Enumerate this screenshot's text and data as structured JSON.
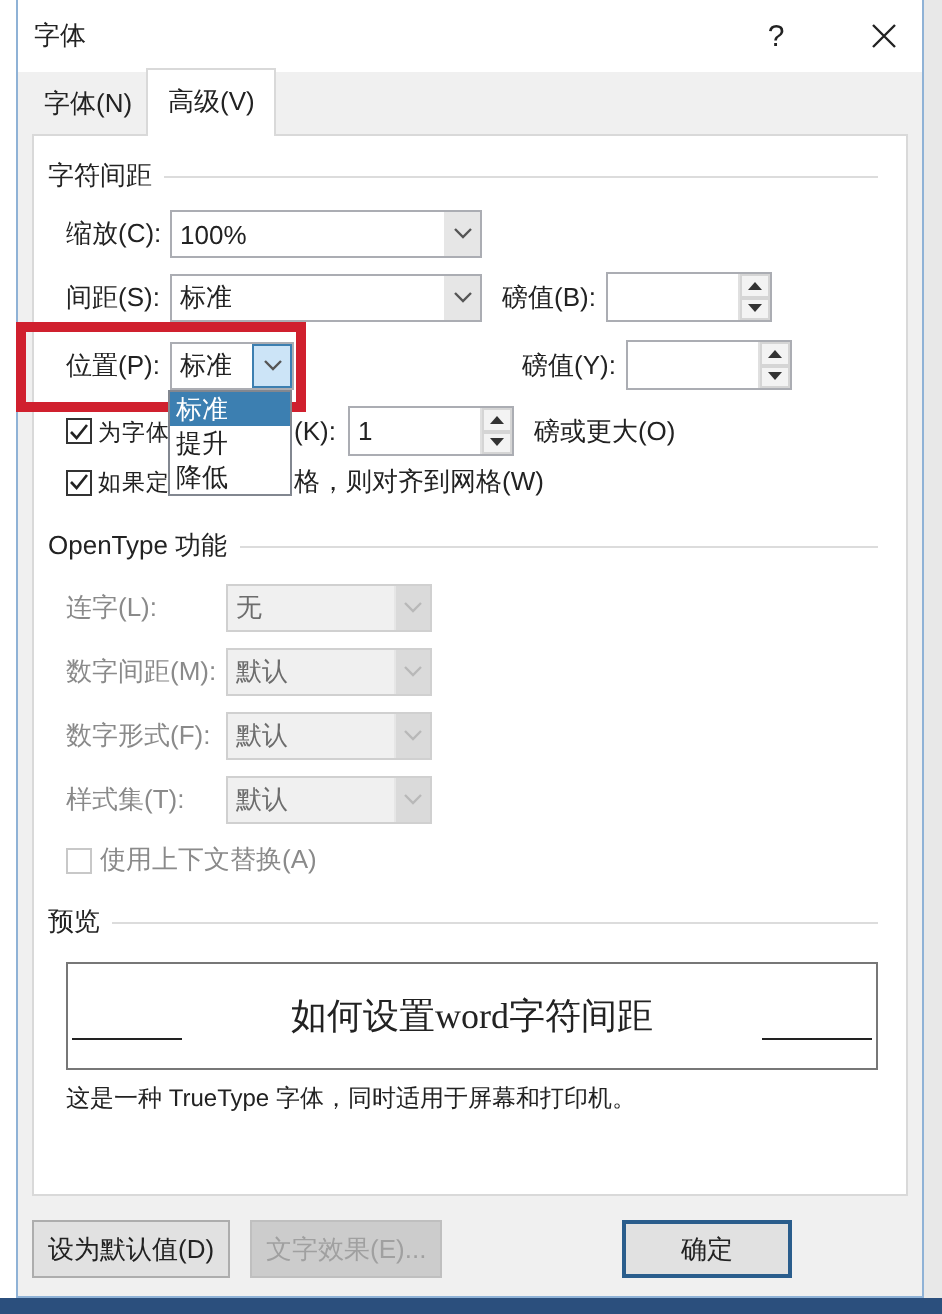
{
  "window": {
    "title": "字体",
    "help_button": "?"
  },
  "tabs": [
    {
      "label": "字体(N)",
      "selected": false
    },
    {
      "label": "高级(V)",
      "selected": true
    }
  ],
  "character_spacing": {
    "heading": "字符间距",
    "scale": {
      "label": "缩放(C):",
      "value": "100%"
    },
    "spacing": {
      "label": "间距(S):",
      "value": "标准",
      "points_label": "磅值(B):"
    },
    "position": {
      "label": "位置(P):",
      "value": "标准",
      "points_label": "磅值(Y):",
      "dropdown": {
        "open": true,
        "options": [
          {
            "label": "标准",
            "selected": true
          },
          {
            "label": "提升",
            "selected": false
          },
          {
            "label": "降低",
            "selected": false
          }
        ]
      }
    },
    "kerning": {
      "checked": true,
      "label_parts": [
        "为字体",
        "(K):"
      ],
      "value": "1",
      "suffix": "磅或更大(O)"
    },
    "snap_to_grid": {
      "checked": true,
      "label_parts": [
        "如果定",
        "格，则对齐到网格(W)"
      ]
    }
  },
  "annotation": {
    "kind": "highlight-box"
  },
  "opentype": {
    "heading": "OpenType 功能",
    "rows": [
      {
        "label": "连字(L):",
        "value": "无",
        "disabled": true
      },
      {
        "label": "数字间距(M):",
        "value": "默认",
        "disabled": true
      },
      {
        "label": "数字形式(F):",
        "value": "默认",
        "disabled": true
      },
      {
        "label": "样式集(T):",
        "value": "默认",
        "disabled": true
      }
    ],
    "contextual": {
      "label": "使用上下文替换(A)",
      "checked": false,
      "disabled": true
    }
  },
  "preview": {
    "heading": "预览",
    "sample": "如何设置word字符间距",
    "note": "这是一种 TrueType 字体，同时适用于屏幕和打印机。"
  },
  "buttons": [
    {
      "label": "设为默认值(D)",
      "disabled": false,
      "default": false
    },
    {
      "label": "文字效果(E)...",
      "disabled": true,
      "default": false
    },
    {
      "label": "确定",
      "disabled": false,
      "default": true
    }
  ]
}
